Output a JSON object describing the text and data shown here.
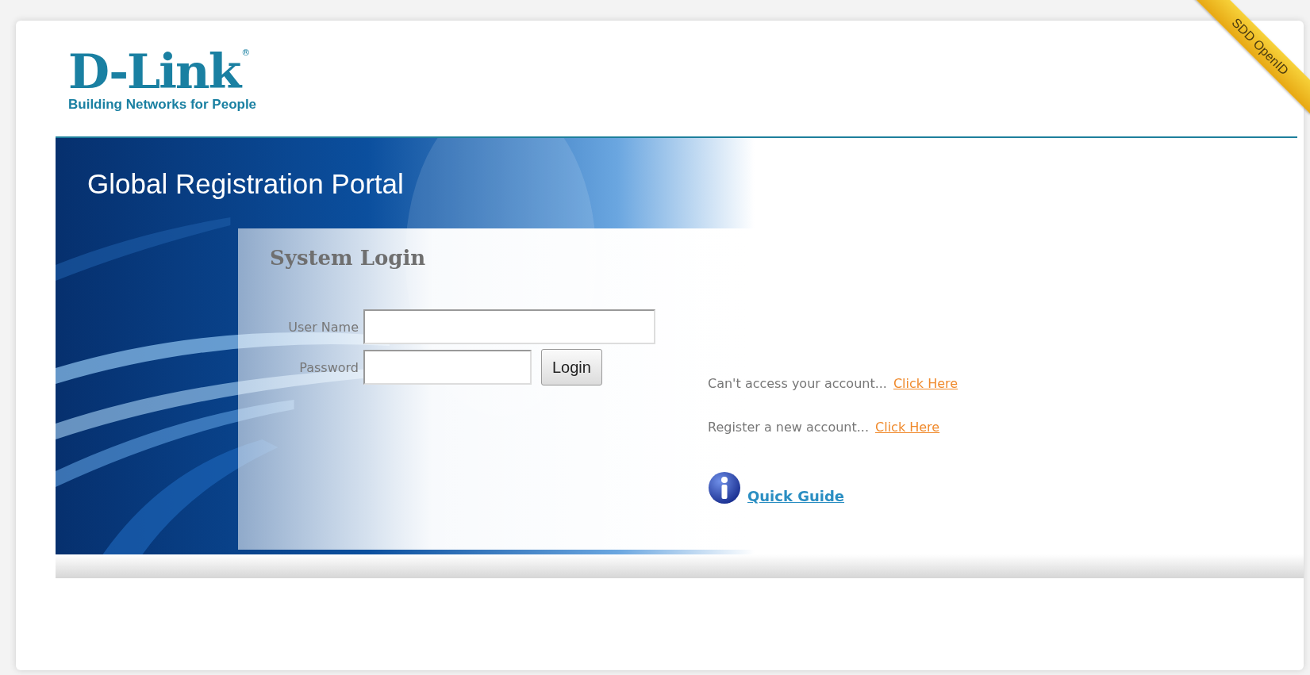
{
  "logo": {
    "wordmark": "D-Link",
    "registered": "®",
    "tagline": "Building Networks for People"
  },
  "ribbon": "SDD OpenID",
  "portal_title": "Global Registration Portal",
  "login": {
    "title": "System Login",
    "fields": [
      {
        "label": "User Name"
      },
      {
        "label": "Password"
      }
    ],
    "button": "Login"
  },
  "links": [
    {
      "text": "Can't access your account...",
      "link": "Click Here"
    },
    {
      "text": "Register a new account...",
      "link": "Click Here"
    }
  ],
  "quick_guide": "Quick Guide"
}
